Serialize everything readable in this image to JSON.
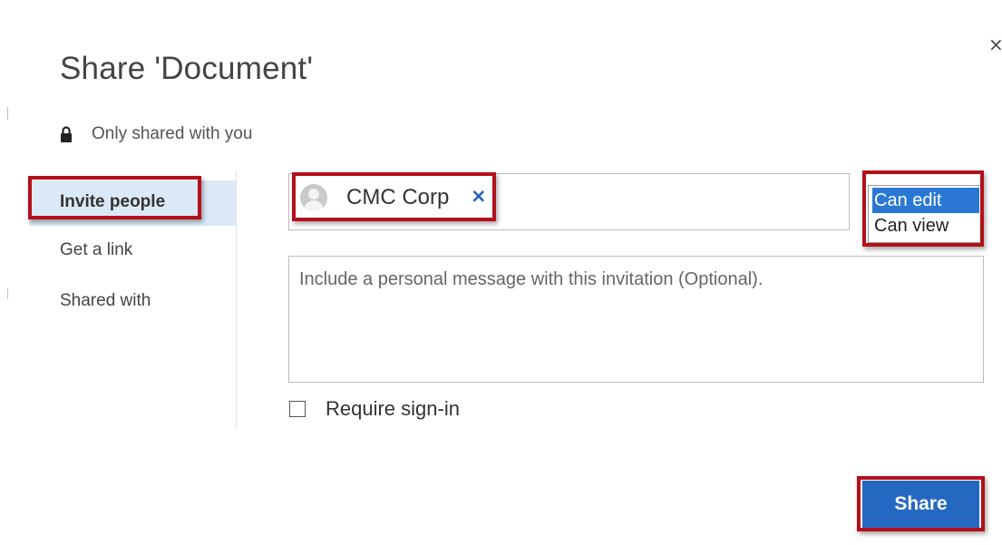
{
  "dialog": {
    "title": "Share 'Document'",
    "status_text": "Only shared with you"
  },
  "nav": {
    "items": [
      {
        "label": "Invite people",
        "active": true
      },
      {
        "label": "Get a link"
      },
      {
        "label": "Shared with"
      }
    ]
  },
  "invite": {
    "recipient": "CMC Corp",
    "remove_glyph": "×"
  },
  "permissions": {
    "options": [
      "Can edit",
      "Can view"
    ],
    "selected": "Can edit"
  },
  "message": {
    "placeholder": "Include a personal message with this invitation (Optional)."
  },
  "require_signin": {
    "label": "Require sign-in",
    "checked": false
  },
  "actions": {
    "share_label": "Share",
    "close_glyph": "×"
  },
  "colors": {
    "accent_blue": "#2568c2",
    "highlight_red": "#b3101a",
    "nav_active_bg": "#dbe8f6"
  },
  "icons": [
    "lock-icon",
    "avatar-icon",
    "close-icon",
    "remove-recipient-icon"
  ]
}
